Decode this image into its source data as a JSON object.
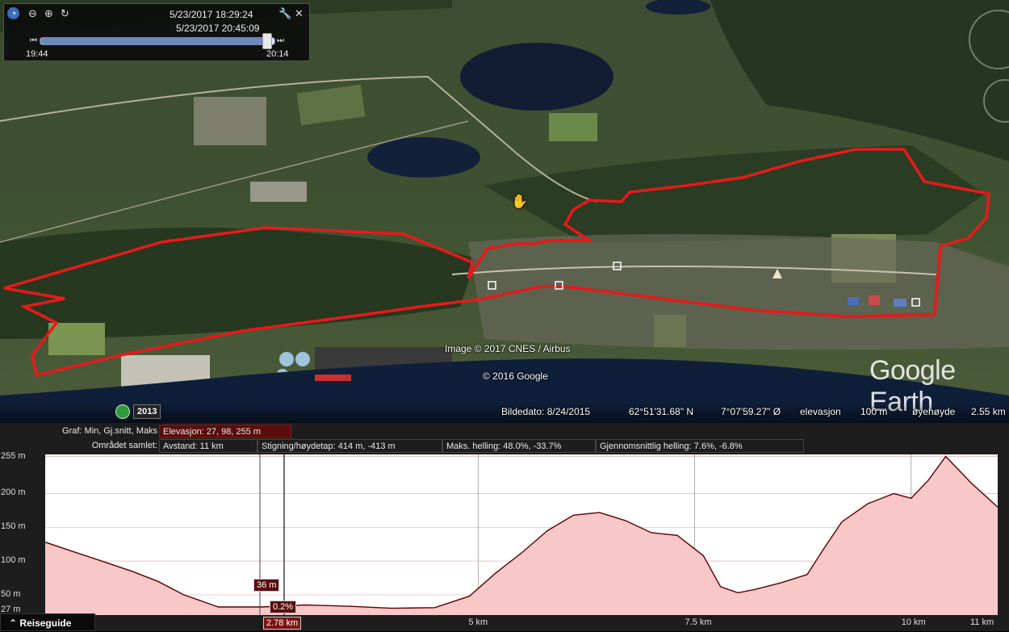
{
  "time_slider": {
    "date_start": "5/23/2017  18:29:24",
    "date_end": "5/23/2017  20:45:09",
    "range_start": "19:44",
    "range_end": "20:14",
    "position": 0.97
  },
  "map": {
    "copyright_image": "Image © 2017 CNES / Airbus",
    "copyright_google": "© 2016 Google",
    "logo": "Google Earth",
    "year_label": "2013"
  },
  "status_bar": {
    "image_date": "Bildedato: 8/24/2015",
    "latitude": "62°51'31.68\" N",
    "longitude": "7°07'59.27\" Ø",
    "elevation_label": "elevasjon",
    "elevation_value": "100 m",
    "eye_label": "øyehøyde",
    "eye_value": "2.55 km"
  },
  "profile": {
    "graph_label": "Graf: Min, Gj.snitt, Maks",
    "elevation": "Elevasjon: 27, 98, 255 m",
    "area_label": "Området samlet:",
    "distance": "Avstand: 11 km",
    "climb": "Stigning/høydetap: 414 m, -413 m",
    "max_slope": "Maks. helling: 48.0%, -33.7%",
    "avg_slope": "Gjennomsnittlig helling: 7.6%, -6.8%",
    "y_ticks": [
      "255 m",
      "200 m",
      "150 m",
      "100 m",
      "50 m",
      "27 m"
    ],
    "x_ticks": [
      "5 km",
      "7.5 km",
      "10 km",
      "11 km"
    ],
    "cursor_elevation": "36 m",
    "cursor_slope": "0.2%",
    "cursor_distance": "2.78 km",
    "guide_button": "Reiseguide"
  },
  "chart_data": {
    "type": "area",
    "x": [
      0,
      0.3,
      0.7,
      1.0,
      1.3,
      1.6,
      2.0,
      2.5,
      3.0,
      3.5,
      4.0,
      4.5,
      4.9,
      5.2,
      5.5,
      5.8,
      6.1,
      6.4,
      6.7,
      7.0,
      7.3,
      7.6,
      7.8,
      8.0,
      8.2,
      8.5,
      8.8,
      9.0,
      9.2,
      9.5,
      9.8,
      10.0,
      10.2,
      10.4,
      10.7,
      11.0
    ],
    "y": [
      128,
      115,
      98,
      85,
      70,
      50,
      32,
      32,
      35,
      33,
      30,
      31,
      48,
      82,
      112,
      145,
      168,
      172,
      160,
      142,
      138,
      108,
      62,
      53,
      58,
      68,
      80,
      120,
      158,
      185,
      200,
      193,
      220,
      255,
      215,
      180
    ],
    "xlabel": "",
    "ylabel": "",
    "xlim": [
      0,
      11
    ],
    "ylim": [
      20,
      258
    ],
    "x_ticks": [
      5,
      7.5,
      10,
      11
    ],
    "y_ticks": [
      27,
      50,
      100,
      150,
      200,
      255
    ],
    "fill_color": "#f8c7c7",
    "line_color": "#5a0000"
  },
  "colors": {
    "track": "#e8191a",
    "panel_bg": "#1d1d1d",
    "accent_red": "#5a0d0d"
  }
}
